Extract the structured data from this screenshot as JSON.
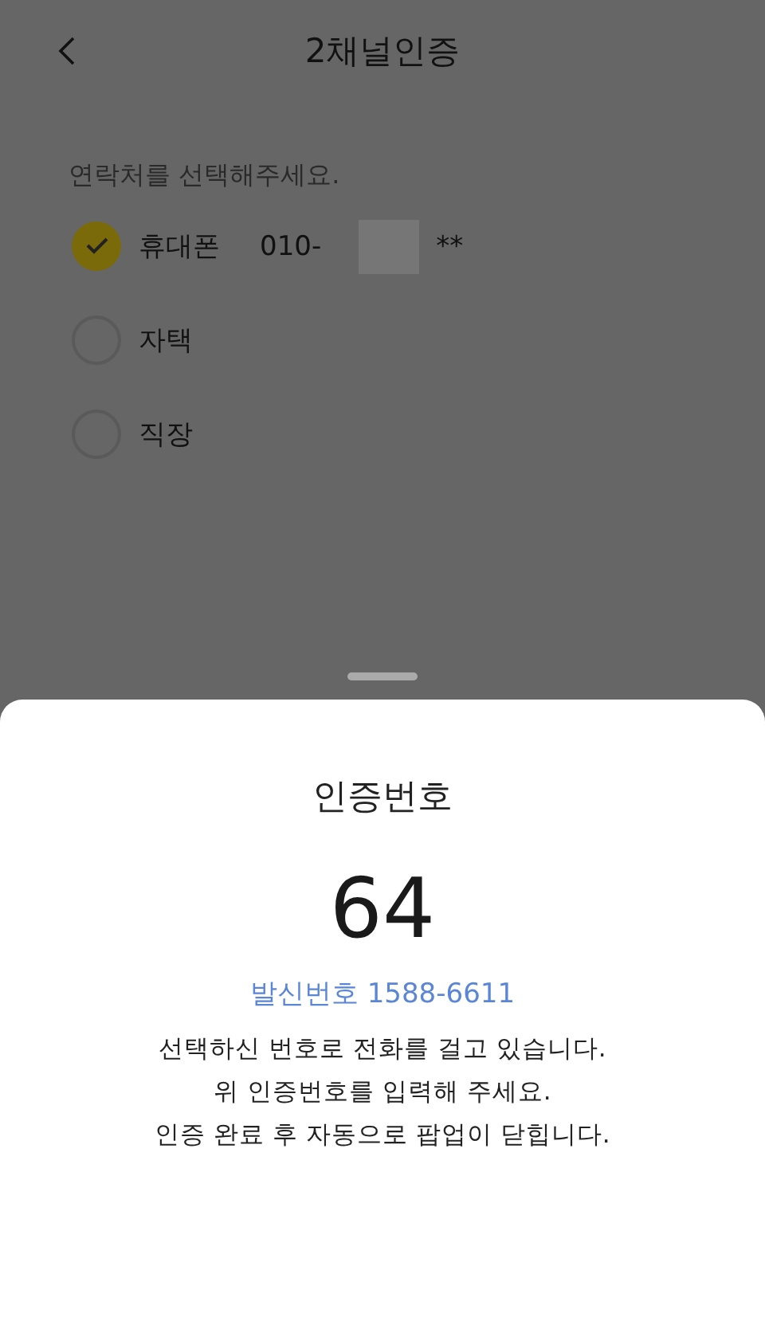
{
  "header": {
    "title": "2채널인증"
  },
  "prompt": "연락처를 선택해주세요.",
  "options": [
    {
      "label": "휴대폰",
      "number_start": "010-",
      "number_end": "**",
      "redacted": true,
      "selected": true
    },
    {
      "label": "자택",
      "selected": false
    },
    {
      "label": "직장",
      "selected": false
    }
  ],
  "sheet": {
    "title": "인증번호",
    "code": "64",
    "sender": "발신번호 1588-6611",
    "message": [
      "선택하신 번호로 전화를 걸고 있습니다.",
      "위 인증번호를 입력해 주세요.",
      "인증 완료 후 자동으로 팝업이 닫힙니다."
    ]
  }
}
